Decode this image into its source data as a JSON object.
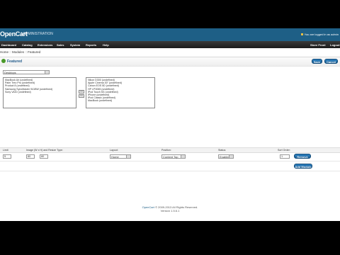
{
  "header": {
    "logo": "OpenCart",
    "subtitle": "| ADMINISTRATION",
    "login_info": "You are logged in as admin"
  },
  "menu": {
    "items": [
      "Dashboard",
      "Catalog",
      "Extensions",
      "Sales",
      "System",
      "Reports",
      "Help"
    ],
    "right_items": [
      "Store Front",
      "Logout"
    ]
  },
  "breadcrumb": [
    "Home",
    "Modules",
    "Featured"
  ],
  "panel": {
    "title": "Featured",
    "save_label": "Save",
    "cancel_label": "Cancel"
  },
  "product_selector": {
    "category_value": "Desktops",
    "left_list": [
      "MacBook Air (undefined)",
      "Palm Treo Pro (undefined)",
      "Product 8 (undefined)",
      "Samsung SyncMaster 941BW (undefined)",
      "Sony VAIO (undefined)"
    ],
    "right_list": [
      "Nikon D300 (undefined)",
      "Apple Cinema 30\" (undefined)",
      "Canon EOS 5D (undefined)",
      "HP LP3065 (undefined)",
      "iPod Touch 5G (undefined)",
      "iPhone (undefined)",
      "iPod Classic (undefined)",
      "MacBook (undefined)"
    ],
    "add_label": ">>",
    "remove_label": "<<"
  },
  "table": {
    "headers": [
      "Limit",
      "Image (W x H) and Resize Type:",
      "Layout:",
      "Position:",
      "Status:",
      "Sort Order:"
    ],
    "row": {
      "limit": "5",
      "width": "80",
      "height": "80",
      "layout": "Home",
      "position": "Content Top",
      "status": "Enabled",
      "sort_order": "1",
      "remove_label": "Remove"
    },
    "add_module_label": "Add Module"
  },
  "footer": {
    "link": "OpenCart",
    "copyright": "© 2009-2013 All Rights Reserved.",
    "version": "Version 1.5.6.1"
  }
}
